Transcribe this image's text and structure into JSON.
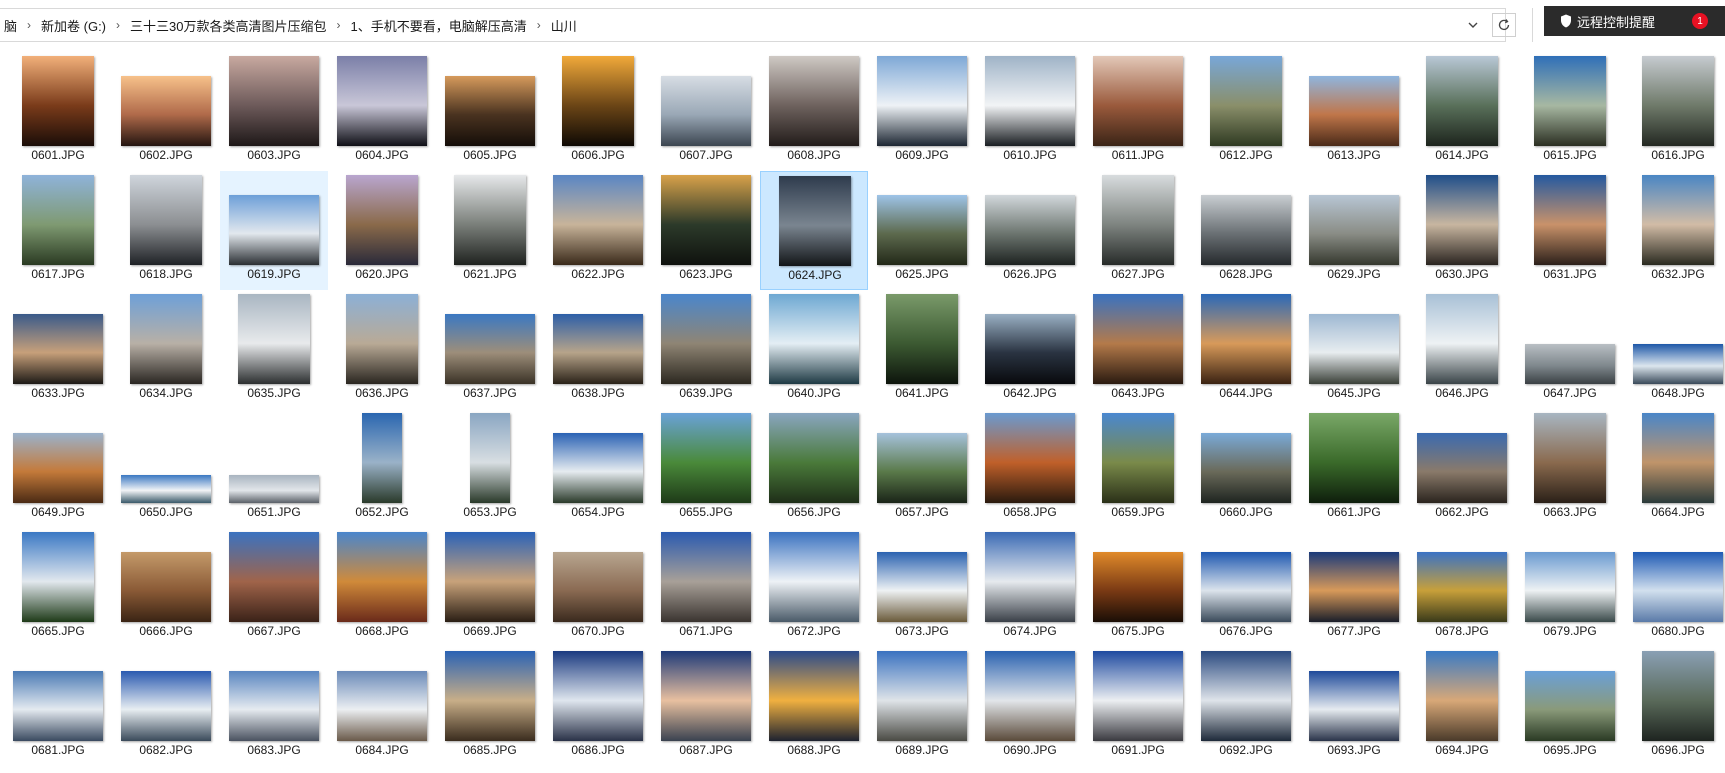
{
  "addressbar": {
    "crumbs": [
      "脑",
      "新加卷 (G:)",
      "三十三30万款各类高清图片压缩包",
      "1、手机不要看，电脑解压高清",
      "山川"
    ],
    "dropdown_icon": "chevron-down-icon",
    "refresh_icon": "refresh-icon"
  },
  "remote_popup": {
    "text": "远程控制提醒",
    "icon": "shield-icon",
    "badge": "1"
  },
  "files": [
    {
      "name": "0601.JPG",
      "shape": "port",
      "colors": [
        "#f2b07a",
        "#7a3b1a",
        "#1a0d08"
      ]
    },
    {
      "name": "0602.JPG",
      "shape": "land",
      "colors": [
        "#f7c18a",
        "#b06a4a",
        "#241510"
      ]
    },
    {
      "name": "0603.JPG",
      "shape": "sq",
      "colors": [
        "#c8a9a0",
        "#6d5a5a",
        "#1e1818"
      ]
    },
    {
      "name": "0604.JPG",
      "shape": "sq",
      "colors": [
        "#7b7fa8",
        "#c9c7d8",
        "#0f0f16"
      ]
    },
    {
      "name": "0605.JPG",
      "shape": "land",
      "colors": [
        "#d69a5c",
        "#4a3320",
        "#140d08"
      ]
    },
    {
      "name": "0606.JPG",
      "shape": "port",
      "colors": [
        "#f1a93a",
        "#6b4516",
        "#0e0904"
      ]
    },
    {
      "name": "0607.JPG",
      "shape": "land",
      "colors": [
        "#d7dde4",
        "#9aa8b6",
        "#3b4550"
      ]
    },
    {
      "name": "0608.JPG",
      "shape": "sq",
      "colors": [
        "#cfc9c4",
        "#6e625e",
        "#221c1a"
      ]
    },
    {
      "name": "0609.JPG",
      "shape": "sq",
      "colors": [
        "#7ea8d6",
        "#eef2f6",
        "#1d2733"
      ]
    },
    {
      "name": "0610.JPG",
      "shape": "sq",
      "colors": [
        "#9fb3c7",
        "#f2f4f6",
        "#1a1e22"
      ]
    },
    {
      "name": "0611.JPG",
      "shape": "sq",
      "colors": [
        "#e3c8b8",
        "#9a5a3c",
        "#3a2416"
      ]
    },
    {
      "name": "0612.JPG",
      "shape": "port",
      "colors": [
        "#78a7d8",
        "#8a8f6a",
        "#2f3a22"
      ]
    },
    {
      "name": "0613.JPG",
      "shape": "land",
      "colors": [
        "#8fb5de",
        "#c0764a",
        "#4a2a18"
      ]
    },
    {
      "name": "0614.JPG",
      "shape": "port",
      "colors": [
        "#b9c8d6",
        "#59705a",
        "#1d241d"
      ]
    },
    {
      "name": "0615.JPG",
      "shape": "port",
      "colors": [
        "#2f6fb8",
        "#a7b8a2",
        "#2b2f22"
      ]
    },
    {
      "name": "0616.JPG",
      "shape": "port",
      "colors": [
        "#c6cbd0",
        "#6f7a6a",
        "#232822"
      ]
    },
    {
      "name": "0617.JPG",
      "shape": "port",
      "colors": [
        "#8fb3da",
        "#7f9a72",
        "#2a3a22"
      ]
    },
    {
      "name": "0618.JPG",
      "shape": "port",
      "colors": [
        "#cfd5dc",
        "#8c8f92",
        "#1f2226"
      ]
    },
    {
      "name": "0619.JPG",
      "shape": "land",
      "colors": [
        "#6d9fd8",
        "#e2e8ee",
        "#2b2f33"
      ]
    },
    {
      "name": "0620.JPG",
      "shape": "port",
      "colors": [
        "#b9a6cf",
        "#8a6a4a",
        "#2a2a3a"
      ]
    },
    {
      "name": "0621.JPG",
      "shape": "port",
      "colors": [
        "#e6e8ea",
        "#7a7f7a",
        "#1f221f"
      ]
    },
    {
      "name": "0622.JPG",
      "shape": "sq",
      "colors": [
        "#5a86c4",
        "#c8b49a",
        "#3a2a1a"
      ]
    },
    {
      "name": "0623.JPG",
      "shape": "sq",
      "colors": [
        "#d9a24a",
        "#2c3a2a",
        "#0f120e"
      ]
    },
    {
      "name": "0624.JPG",
      "shape": "port",
      "colors": [
        "#2e3b4d",
        "#7a8590",
        "#121518"
      ]
    },
    {
      "name": "0625.JPG",
      "shape": "land",
      "colors": [
        "#9ec4e8",
        "#5d6a4e",
        "#222818"
      ]
    },
    {
      "name": "0626.JPG",
      "shape": "land",
      "colors": [
        "#d2d8dc",
        "#6c756f",
        "#1d2220"
      ]
    },
    {
      "name": "0627.JPG",
      "shape": "port",
      "colors": [
        "#d8dcde",
        "#7e8480",
        "#272b29"
      ]
    },
    {
      "name": "0628.JPG",
      "shape": "land",
      "colors": [
        "#c9ced2",
        "#6a7074",
        "#25292c"
      ]
    },
    {
      "name": "0629.JPG",
      "shape": "land",
      "colors": [
        "#b8c6d4",
        "#8a8d86",
        "#35382e"
      ]
    },
    {
      "name": "0630.JPG",
      "shape": "port",
      "colors": [
        "#1f4e8a",
        "#c8b6a0",
        "#2a2420"
      ]
    },
    {
      "name": "0631.JPG",
      "shape": "port",
      "colors": [
        "#2459a0",
        "#c9926a",
        "#2c201a"
      ]
    },
    {
      "name": "0632.JPG",
      "shape": "port",
      "colors": [
        "#4a86c4",
        "#d2bca6",
        "#2a2a20"
      ]
    },
    {
      "name": "0633.JPG",
      "shape": "land",
      "colors": [
        "#3a5a8a",
        "#c7a07a",
        "#1d1a16"
      ]
    },
    {
      "name": "0634.JPG",
      "shape": "port",
      "colors": [
        "#6ea0d8",
        "#b8b0a6",
        "#2a2622"
      ]
    },
    {
      "name": "0635.JPG",
      "shape": "port",
      "colors": [
        "#a9b6c2",
        "#e8eaec",
        "#2c2f30"
      ]
    },
    {
      "name": "0636.JPG",
      "shape": "port",
      "colors": [
        "#8cb0d6",
        "#b9aa96",
        "#2a2620"
      ]
    },
    {
      "name": "0637.JPG",
      "shape": "land",
      "colors": [
        "#3b78c2",
        "#9d8e7a",
        "#3a3226"
      ]
    },
    {
      "name": "0638.JPG",
      "shape": "land",
      "colors": [
        "#2d5fa8",
        "#b7a48a",
        "#2a2218"
      ]
    },
    {
      "name": "0639.JPG",
      "shape": "sq",
      "colors": [
        "#4a86cc",
        "#8f8574",
        "#2c2820"
      ]
    },
    {
      "name": "0640.JPG",
      "shape": "sq",
      "colors": [
        "#6ea8d2",
        "#e4eef4",
        "#1e3a44"
      ]
    },
    {
      "name": "0641.JPG",
      "shape": "port",
      "colors": [
        "#7a9a6a",
        "#3c5a32",
        "#0d140c"
      ]
    },
    {
      "name": "0642.JPG",
      "shape": "land",
      "colors": [
        "#9ab0c4",
        "#2a3442",
        "#08090c"
      ]
    },
    {
      "name": "0643.JPG",
      "shape": "sq",
      "colors": [
        "#3a72c0",
        "#b47a4a",
        "#2a1a10"
      ]
    },
    {
      "name": "0644.JPG",
      "shape": "sq",
      "colors": [
        "#2a68b8",
        "#d89a5a",
        "#3a2212"
      ]
    },
    {
      "name": "0645.JPG",
      "shape": "land",
      "colors": [
        "#9eb8d2",
        "#e8edf0",
        "#3a4038"
      ]
    },
    {
      "name": "0646.JPG",
      "shape": "port",
      "colors": [
        "#a8c0d6",
        "#eef2f4",
        "#3a4448"
      ]
    },
    {
      "name": "0647.JPG",
      "shape": "wide",
      "colors": [
        "#b9bfc4",
        "#7e878c",
        "#3a4044"
      ]
    },
    {
      "name": "0648.JPG",
      "shape": "wide",
      "colors": [
        "#1e58a8",
        "#dce6ee",
        "#3a4a5a"
      ]
    },
    {
      "name": "0649.JPG",
      "shape": "land",
      "colors": [
        "#9ab2cc",
        "#c47a3a",
        "#4a2a14"
      ]
    },
    {
      "name": "0650.JPG",
      "shape": "pano",
      "colors": [
        "#3a78c2",
        "#f2f4f6",
        "#3a5a6a"
      ]
    },
    {
      "name": "0651.JPG",
      "shape": "pano",
      "colors": [
        "#a8b4c0",
        "#e2e6ea",
        "#5a6068"
      ]
    },
    {
      "name": "0652.JPG",
      "shape": "narrow",
      "colors": [
        "#2a66b0",
        "#9ab2c8",
        "#2a3a2a"
      ]
    },
    {
      "name": "0653.JPG",
      "shape": "narrow",
      "colors": [
        "#8aa6c2",
        "#d8dee2",
        "#2a3a2a"
      ]
    },
    {
      "name": "0654.JPG",
      "shape": "land",
      "colors": [
        "#2a62b4",
        "#e6ecf0",
        "#2a3a2a"
      ]
    },
    {
      "name": "0655.JPG",
      "shape": "sq",
      "colors": [
        "#6aa2d8",
        "#4a8a3a",
        "#1e3a18"
      ]
    },
    {
      "name": "0656.JPG",
      "shape": "sq",
      "colors": [
        "#8aa6c0",
        "#4a7a3a",
        "#1e2e18"
      ]
    },
    {
      "name": "0657.JPG",
      "shape": "land",
      "colors": [
        "#a6c2dc",
        "#5a7a4a",
        "#1a2418"
      ]
    },
    {
      "name": "0658.JPG",
      "shape": "sq",
      "colors": [
        "#6a9ad0",
        "#c0602a",
        "#2a1a0e"
      ]
    },
    {
      "name": "0659.JPG",
      "shape": "port",
      "colors": [
        "#4a88d0",
        "#7a8a4a",
        "#2a3018"
      ]
    },
    {
      "name": "0660.JPG",
      "shape": "land",
      "colors": [
        "#7aaad8",
        "#6a6a5a",
        "#1e2420"
      ]
    },
    {
      "name": "0661.JPG",
      "shape": "sq",
      "colors": [
        "#7aa868",
        "#3a6a2a",
        "#0e1e0c"
      ]
    },
    {
      "name": "0662.JPG",
      "shape": "land",
      "colors": [
        "#3a6ab0",
        "#8a7a6a",
        "#2a241e"
      ]
    },
    {
      "name": "0663.JPG",
      "shape": "port",
      "colors": [
        "#a8b6c2",
        "#8a6a4e",
        "#2a2018"
      ]
    },
    {
      "name": "0664.JPG",
      "shape": "port",
      "colors": [
        "#4a86c8",
        "#c0946a",
        "#2a3a3a"
      ]
    },
    {
      "name": "0665.JPG",
      "shape": "port",
      "colors": [
        "#3a78c4",
        "#e2e8ee",
        "#1e3a18"
      ]
    },
    {
      "name": "0666.JPG",
      "shape": "land",
      "colors": [
        "#c49a6a",
        "#8a5a36",
        "#3a2414"
      ]
    },
    {
      "name": "0667.JPG",
      "shape": "sq",
      "colors": [
        "#3a72c0",
        "#a0644a",
        "#3a2218"
      ]
    },
    {
      "name": "0668.JPG",
      "shape": "sq",
      "colors": [
        "#4a86cc",
        "#d08a3a",
        "#6a2a1a"
      ]
    },
    {
      "name": "0669.JPG",
      "shape": "sq",
      "colors": [
        "#2a62b8",
        "#c8a27a",
        "#2a1e14"
      ]
    },
    {
      "name": "0670.JPG",
      "shape": "land",
      "colors": [
        "#b8a690",
        "#8a6a52",
        "#3a2a1e"
      ]
    },
    {
      "name": "0671.JPG",
      "shape": "sq",
      "colors": [
        "#2a5ab0",
        "#a8a098",
        "#3a3430"
      ]
    },
    {
      "name": "0672.JPG",
      "shape": "sq",
      "colors": [
        "#3a72c0",
        "#eef2f6",
        "#4a5a68"
      ]
    },
    {
      "name": "0673.JPG",
      "shape": "land",
      "colors": [
        "#2a62b0",
        "#eef2f4",
        "#6a5a3a"
      ]
    },
    {
      "name": "0674.JPG",
      "shape": "sq",
      "colors": [
        "#3a6ab4",
        "#e6eaee",
        "#3a4048"
      ]
    },
    {
      "name": "0675.JPG",
      "shape": "land",
      "colors": [
        "#e08a2a",
        "#7a3a14",
        "#1a0e06"
      ]
    },
    {
      "name": "0676.JPG",
      "shape": "land",
      "colors": [
        "#1e58b0",
        "#dce4ec",
        "#3a4a5a"
      ]
    },
    {
      "name": "0677.JPG",
      "shape": "land",
      "colors": [
        "#1a3a7a",
        "#d89a5a",
        "#1a1e2a"
      ]
    },
    {
      "name": "0678.JPG",
      "shape": "land",
      "colors": [
        "#3a72c4",
        "#c8a03a",
        "#3a3a1a"
      ]
    },
    {
      "name": "0679.JPG",
      "shape": "land",
      "colors": [
        "#6a9ad0",
        "#eef2f4",
        "#3a4a4a"
      ]
    },
    {
      "name": "0680.JPG",
      "shape": "land",
      "colors": [
        "#1e5ab4",
        "#d2e0ee",
        "#5a7aa8"
      ]
    },
    {
      "name": "0681.JPG",
      "shape": "land",
      "colors": [
        "#4a7ab4",
        "#e4eaf0",
        "#3a4a60"
      ]
    },
    {
      "name": "0682.JPG",
      "shape": "land",
      "colors": [
        "#2a5ab0",
        "#e8eef2",
        "#3a4a5a"
      ]
    },
    {
      "name": "0683.JPG",
      "shape": "land",
      "colors": [
        "#5a86c0",
        "#e6ebf0",
        "#4a5260"
      ]
    },
    {
      "name": "0684.JPG",
      "shape": "land",
      "colors": [
        "#6a8ab8",
        "#eceff2",
        "#6a5a4a"
      ]
    },
    {
      "name": "0685.JPG",
      "shape": "sq",
      "colors": [
        "#2a62b4",
        "#c8ae88",
        "#3a2c1e"
      ]
    },
    {
      "name": "0686.JPG",
      "shape": "sq",
      "colors": [
        "#1a3a80",
        "#dfe6ee",
        "#2a3248"
      ]
    },
    {
      "name": "0687.JPG",
      "shape": "sq",
      "colors": [
        "#1e3a78",
        "#e8c0a0",
        "#3a4250"
      ]
    },
    {
      "name": "0688.JPG",
      "shape": "sq",
      "colors": [
        "#2a4a8a",
        "#f0b040",
        "#1e2230"
      ]
    },
    {
      "name": "0689.JPG",
      "shape": "sq",
      "colors": [
        "#3a72c0",
        "#dfe4e8",
        "#4a4a44"
      ]
    },
    {
      "name": "0690.JPG",
      "shape": "sq",
      "colors": [
        "#2a62b0",
        "#e2e6ea",
        "#5a4a3a"
      ]
    },
    {
      "name": "0691.JPG",
      "shape": "sq",
      "colors": [
        "#1e4aa0",
        "#eceff2",
        "#3a3a40"
      ]
    },
    {
      "name": "0692.JPG",
      "shape": "sq",
      "colors": [
        "#2a4a80",
        "#dfe4ea",
        "#1e2a3a"
      ]
    },
    {
      "name": "0693.JPG",
      "shape": "land",
      "colors": [
        "#1e4a9a",
        "#e6ebf0",
        "#2a344a"
      ]
    },
    {
      "name": "0694.JPG",
      "shape": "port",
      "colors": [
        "#3a7ac4",
        "#d8a878",
        "#4a3a2a"
      ]
    },
    {
      "name": "0695.JPG",
      "shape": "land",
      "colors": [
        "#6aa0d8",
        "#8a9a7a",
        "#2a3a24"
      ]
    },
    {
      "name": "0696.JPG",
      "shape": "port",
      "colors": [
        "#8aa0b4",
        "#5a6a5a",
        "#1e2420"
      ]
    }
  ]
}
